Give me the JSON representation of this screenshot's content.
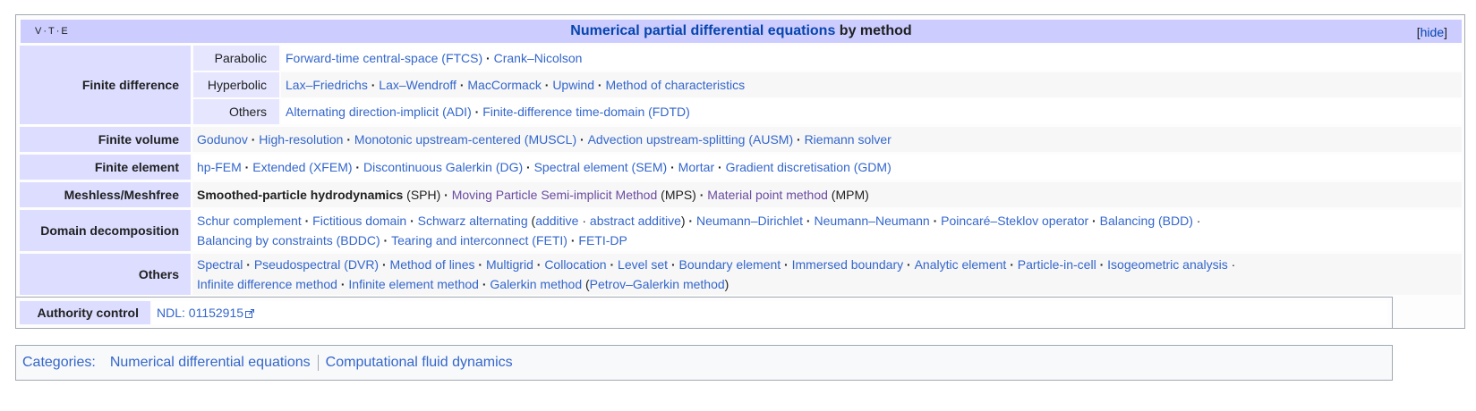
{
  "navbox": {
    "vte": [
      "V",
      "T",
      "E"
    ],
    "title_link": "Numerical partial differential equations",
    "title_rest": " by method",
    "hide_label": "hide",
    "groups": [
      {
        "label": "Finite difference",
        "subgroups": [
          {
            "label": "Parabolic",
            "items": [
              "Forward-time central-space (FTCS)",
              "Crank–Nicolson"
            ]
          },
          {
            "label": "Hyperbolic",
            "items": [
              "Lax–Friedrichs",
              "Lax–Wendroff",
              "MacCormack",
              "Upwind",
              "Method of characteristics"
            ]
          },
          {
            "label": "Others",
            "items": [
              "Alternating direction-implicit (ADI)",
              "Finite-difference time-domain (FDTD)"
            ]
          }
        ]
      },
      {
        "label": "Finite volume",
        "items": [
          "Godunov",
          "High-resolution",
          "Monotonic upstream-centered (MUSCL)",
          "Advection upstream-splitting (AUSM)",
          "Riemann solver"
        ]
      },
      {
        "label": "Finite element",
        "items": [
          "hp-FEM",
          "Extended (XFEM)",
          "Discontinuous Galerkin (DG)",
          "Spectral element (SEM)",
          "Mortar",
          "Gradient discretisation (GDM)"
        ]
      },
      {
        "label": "Meshless/Meshfree",
        "items_rich": [
          {
            "bold": "Smoothed-particle hydrodynamics",
            "suffix": " (SPH)"
          },
          {
            "link": "Moving Particle Semi-implicit Method",
            "suffix": " (MPS)"
          },
          {
            "link": "Material point method",
            "suffix": " (MPM)"
          }
        ]
      },
      {
        "label": "Domain decomposition",
        "line1": [
          "Schur complement",
          "Fictitious domain"
        ],
        "schwarz": {
          "link": "Schwarz alternating",
          "sub": [
            "additive",
            "abstract additive"
          ]
        },
        "line1b": [
          "Neumann–Dirichlet",
          "Neumann–Neumann",
          "Poincaré–Steklov operator",
          "Balancing (BDD)"
        ],
        "line2": [
          "Balancing by constraints (BDDC)",
          "Tearing and interconnect (FETI)",
          "FETI-DP"
        ]
      },
      {
        "label": "Others",
        "line1": [
          "Spectral",
          "Pseudospectral (DVR)",
          "Method of lines",
          "Multigrid",
          "Collocation",
          "Level set",
          "Boundary element",
          "Immersed boundary",
          "Analytic element",
          "Particle-in-cell",
          "Isogeometric analysis"
        ],
        "line2": [
          "Infinite difference method",
          "Infinite element method"
        ],
        "galerkin": {
          "link": "Galerkin method",
          "sub": "Petrov–Galerkin method"
        }
      }
    ]
  },
  "authority": {
    "label": "Authority control",
    "value": "NDL: 01152915"
  },
  "categories": {
    "label": "Categories",
    "items": [
      "Numerical differential equations",
      "Computational fluid dynamics"
    ]
  },
  "colors": {
    "title_bg": "#ccccff",
    "group_bg": "#ddddff",
    "link": "#3366cc",
    "visited": "#6b4ba1"
  }
}
